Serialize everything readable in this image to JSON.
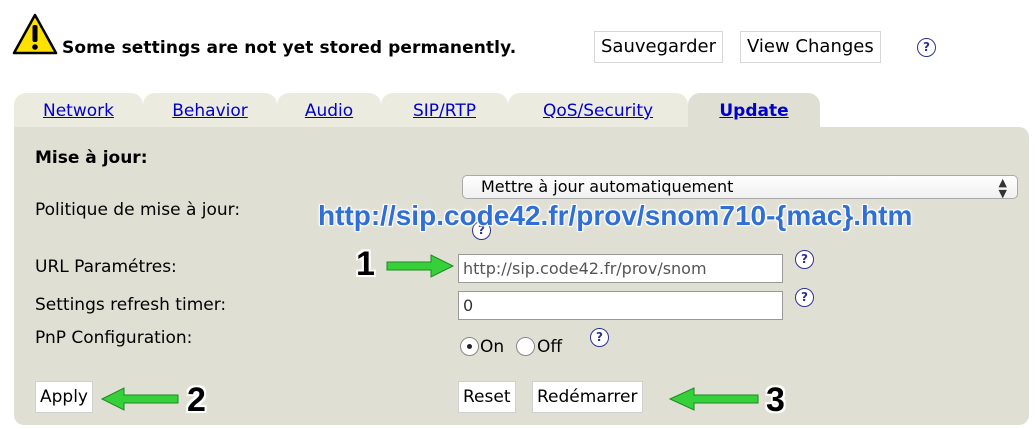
{
  "warning": {
    "message": "Some settings are not yet stored permanently.",
    "save_label": "Sauvegarder",
    "view_changes_label": "View Changes"
  },
  "help_glyph": "?",
  "tabs": [
    {
      "label": "Network",
      "active": false
    },
    {
      "label": "Behavior",
      "active": false
    },
    {
      "label": "Audio",
      "active": false
    },
    {
      "label": "SIP/RTP",
      "active": false
    },
    {
      "label": "QoS/Security",
      "active": false
    },
    {
      "label": "Update",
      "active": true
    }
  ],
  "section": {
    "title": "Mise à jour:",
    "policy_label": "Politique de mise à jour:",
    "policy_value": "Mettre à jour automatiquement",
    "url_label": "URL Paramétres:",
    "url_value": "http://sip.code42.fr/prov/snom",
    "timer_label": "Settings refresh timer:",
    "timer_value": "0",
    "pnp_label": "PnP Configuration:",
    "pnp_on": "On",
    "pnp_off": "Off",
    "pnp_selected": "On"
  },
  "buttons": {
    "apply": "Apply",
    "reset": "Reset",
    "reboot": "Redémarrer"
  },
  "annotations": {
    "url_overlay": "http://sip.code42.fr/prov/snom710-{mac}.htm",
    "step1": "1",
    "step2": "2",
    "step3": "3",
    "arrow_color": "#2ecc40",
    "overlay_color": "#2f6fd6"
  },
  "icons": {
    "warning": "warning-triangle-icon",
    "help": "help-question-icon",
    "select": "select-arrows-icon",
    "arrow": "green-arrow-icon"
  }
}
